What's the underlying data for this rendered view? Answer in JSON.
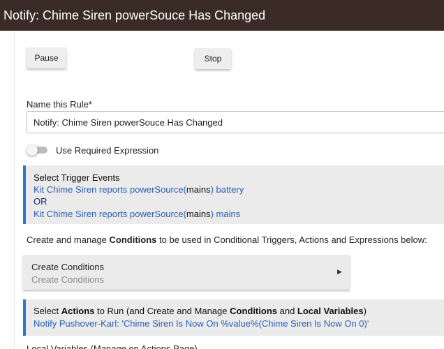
{
  "header": {
    "title": "Notify: Chime Siren powerSouce Has Changed"
  },
  "controls": {
    "pause_label": "Pause",
    "stop_label": "Stop"
  },
  "rule_name": {
    "label": "Name this Rule*",
    "value": "Notify: Chime Siren powerSouce Has Changed"
  },
  "required_expression": {
    "label": "Use Required Expression",
    "enabled": false
  },
  "triggers": {
    "heading": "Select Trigger Events",
    "items": [
      {
        "prefix": "Kit Chime Siren reports powerSource(",
        "value": "mains",
        "suffix": ") battery"
      },
      {
        "prefix": "Kit Chime Siren reports powerSource(",
        "value": "mains",
        "suffix": ") mains"
      }
    ],
    "separator": "OR"
  },
  "conditions": {
    "description_pre": "Create and manage ",
    "description_bold": "Conditions",
    "description_post": " to be used in Conditional Triggers, Actions and Expressions below:",
    "card_title": "Create Conditions",
    "card_subtitle": "Create Conditions",
    "arrow_icon": "triangle-right-icon"
  },
  "actions": {
    "heading_1": "Select ",
    "heading_bold_1": "Actions",
    "heading_2": " to Run (and Create and Manage ",
    "heading_bold_2": "Conditions",
    "heading_3": " and ",
    "heading_bold_3": "Local Variables",
    "heading_4": ")",
    "action_text": "Notify Pushover-Karl: 'Chime Siren Is Now On %value%(Chime Siren Is Now On 0)'"
  },
  "local_vars": {
    "label": "Local Variables (Manage on Actions Page)"
  }
}
